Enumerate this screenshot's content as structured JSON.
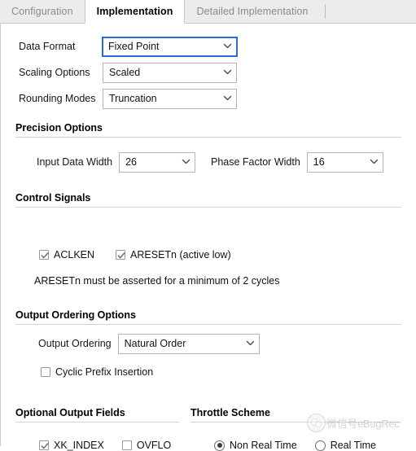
{
  "tabs": [
    {
      "label": "Configuration",
      "active": false
    },
    {
      "label": "Implementation",
      "active": true
    },
    {
      "label": "Detailed Implementation",
      "active": false
    }
  ],
  "top_fields": [
    {
      "label": "Data Format",
      "value": "Fixed Point",
      "focused": true
    },
    {
      "label": "Scaling Options",
      "value": "Scaled",
      "focused": false
    },
    {
      "label": "Rounding Modes",
      "value": "Truncation",
      "focused": false
    }
  ],
  "precision": {
    "title": "Precision Options",
    "input_data_width": {
      "label": "Input Data Width",
      "value": "26"
    },
    "phase_factor_width": {
      "label": "Phase Factor Width",
      "value": "16"
    }
  },
  "control_signals": {
    "title": "Control Signals",
    "aclken": {
      "label": "ACLKEN",
      "checked": true
    },
    "aresetn": {
      "label": "ARESETn (active low)",
      "checked": true
    },
    "note": "ARESETn must be asserted for a minimum of 2 cycles"
  },
  "output_ordering": {
    "title": "Output Ordering Options",
    "ordering": {
      "label": "Output Ordering",
      "value": "Natural Order"
    },
    "cyclic_prefix": {
      "label": "Cyclic Prefix Insertion",
      "checked": false
    }
  },
  "optional_output_fields": {
    "title": "Optional Output Fields",
    "xk_index": {
      "label": "XK_INDEX",
      "checked": true
    },
    "ovflo": {
      "label": "OVFLO",
      "checked": false
    }
  },
  "throttle_scheme": {
    "title": "Throttle Scheme",
    "non_real_time": {
      "label": "Non Real Time",
      "selected": true
    },
    "real_time": {
      "label": "Real Time",
      "selected": false
    }
  },
  "watermark": {
    "text": "微信号eBugRec"
  },
  "colors": {
    "focus_border": "#2a6dd0",
    "tab_bar_bg": "#ececec",
    "rule": "#d2d2d2"
  }
}
